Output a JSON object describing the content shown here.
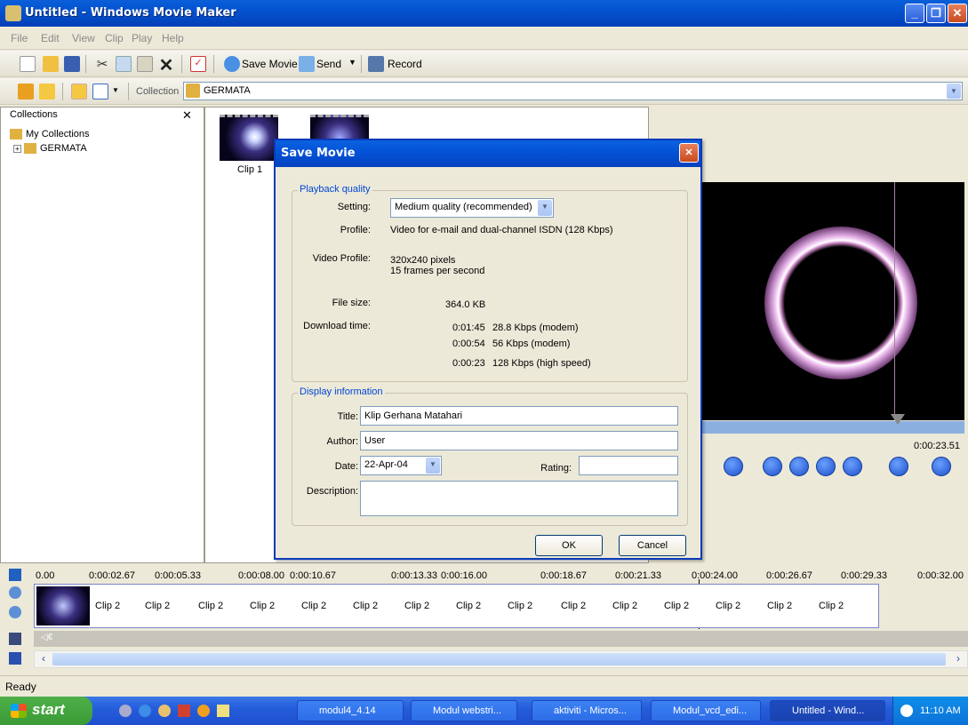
{
  "window": {
    "title": "Untitled - Windows Movie Maker"
  },
  "menu": [
    "File",
    "Edit",
    "View",
    "Clip",
    "Play",
    "Help"
  ],
  "toolbar": {
    "save_movie": "Save Movie",
    "send": "Send",
    "record": "Record"
  },
  "collection_bar": {
    "label": "Collection",
    "value": "GERMATA"
  },
  "collections": {
    "title": "Collections",
    "root": "My Collections",
    "child": "GERMATA"
  },
  "content": {
    "clips": [
      "Clip 1"
    ]
  },
  "preview": {
    "time": "0:00:23.51"
  },
  "dialog": {
    "title": "Save Movie",
    "playback": {
      "legend": "Playback quality",
      "setting_label": "Setting:",
      "setting_value": "Medium quality (recommended)",
      "profile_label": "Profile:",
      "profile_value": "Video for e-mail and dual-channel ISDN (128 Kbps)",
      "video_profile_label": "Video Profile:",
      "video_profile_line1": "320x240 pixels",
      "video_profile_line2": "15 frames per second",
      "filesize_label": "File size:",
      "filesize_value": "364.0 KB",
      "download_label": "Download time:",
      "download_rows": [
        {
          "time": "0:01:45",
          "speed": "28.8 Kbps (modem)"
        },
        {
          "time": "0:00:54",
          "speed": "56 Kbps (modem)"
        },
        {
          "time": "0:00:23",
          "speed": "128 Kbps (high speed)"
        }
      ]
    },
    "display": {
      "legend": "Display information",
      "title_label": "Title:",
      "title_value": "Klip Gerhana Matahari",
      "author_label": "Author:",
      "author_value": "User",
      "date_label": "Date:",
      "date_value": "22-Apr-04",
      "rating_label": "Rating:",
      "rating_value": "",
      "description_label": "Description:",
      "description_value": ""
    },
    "ok": "OK",
    "cancel": "Cancel"
  },
  "timeline": {
    "ticks": [
      "0.00",
      "0:00:02.67",
      "0:00:05.33",
      "0:00:08.00",
      "0:00:10.67",
      "0:00:13.33",
      "0:00:16.00",
      "0:00:18.67",
      "0:00:21.33",
      "0:00:24.00",
      "0:00:26.67",
      "0:00:29.33",
      "0:00:32.00"
    ],
    "clips": [
      "Clip 2",
      "Clip 2",
      "Clip 2",
      "Clip 2",
      "Clip 2",
      "Clip 2",
      "Clip 2",
      "Clip 2",
      "Clip 2",
      "Clip 2",
      "Clip 2",
      "Clip 2",
      "Clip 2",
      "Clip 2",
      "Clip 2"
    ]
  },
  "status": {
    "text": "Ready"
  },
  "taskbar": {
    "start": "start",
    "tasks": [
      "modul4_4.14",
      "Modul webstri...",
      "aktiviti - Micros...",
      "Modul_vcd_edi...",
      "Untitled - Wind..."
    ],
    "clock": "11:10 AM"
  }
}
